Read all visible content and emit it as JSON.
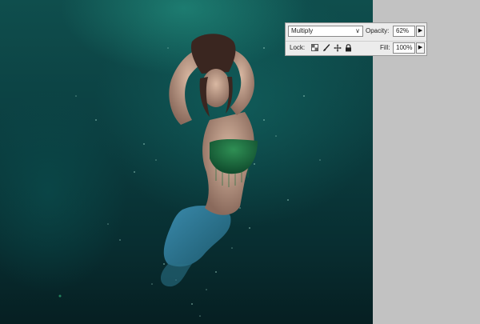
{
  "layers_panel": {
    "blend_mode": "Multiply",
    "opacity_label": "Opacity:",
    "opacity_value": "62%",
    "lock_label": "Lock:",
    "fill_label": "Fill:",
    "fill_value": "100%"
  },
  "icons": {
    "blend_dropdown": "chevron-down-icon",
    "opacity_flyout": "triangle-right-icon",
    "fill_flyout": "triangle-right-icon",
    "lock_transparent": "checkerboard-icon",
    "lock_image": "brush-icon",
    "lock_position": "move-icon",
    "lock_all": "padlock-icon"
  },
  "colors": {
    "canvas_top": "#0f4e4d",
    "canvas_bottom": "#061f22",
    "pasteboard": "#c2c2c2",
    "panel_bg": "#ececec"
  }
}
